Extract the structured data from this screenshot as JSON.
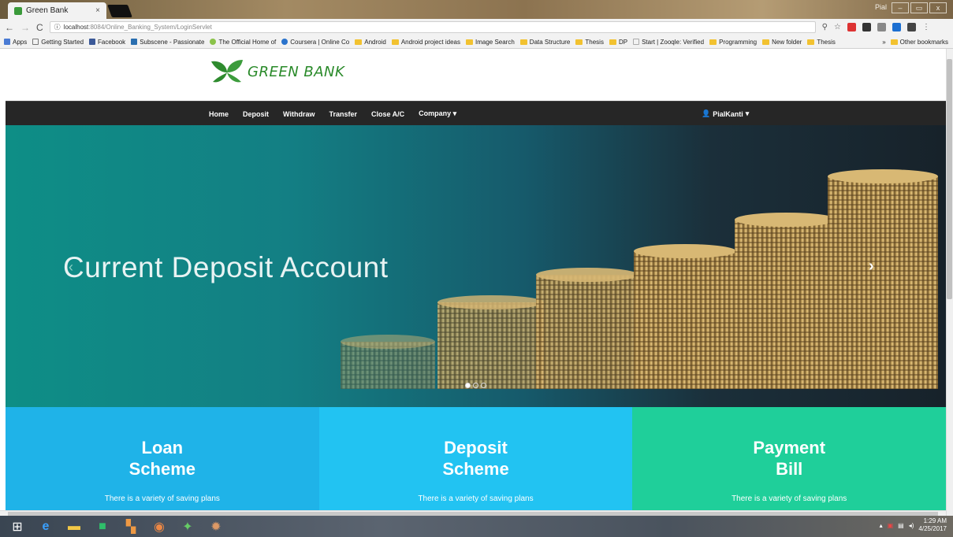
{
  "browser": {
    "tab_title": "Green Bank",
    "tab_close": "×",
    "url_host": "localhost",
    "url_path": ":8084/Online_Banking_System/LoginServlet",
    "win_controls": [
      "–",
      "▭",
      "x"
    ]
  },
  "bookmarks": {
    "items": [
      {
        "label": "Apps",
        "kind": "apps"
      },
      {
        "label": "Getting Started",
        "kind": "page"
      },
      {
        "label": "Facebook",
        "kind": "fb"
      },
      {
        "label": "Subscene - Passionate",
        "kind": "s"
      },
      {
        "label": "The Official Home of",
        "kind": "page"
      },
      {
        "label": "Coursera | Online Co",
        "kind": "page"
      },
      {
        "label": "Android",
        "kind": "folder"
      },
      {
        "label": "Android project ideas",
        "kind": "folder"
      },
      {
        "label": "Image Search",
        "kind": "folder"
      },
      {
        "label": "Data Structure",
        "kind": "folder"
      },
      {
        "label": "Thesis",
        "kind": "folder"
      },
      {
        "label": "DP",
        "kind": "folder"
      },
      {
        "label": "Start | Zooqle: Verified",
        "kind": "page"
      },
      {
        "label": "Programming",
        "kind": "folder"
      },
      {
        "label": "New folder",
        "kind": "folder"
      },
      {
        "label": "Thesis",
        "kind": "folder"
      }
    ],
    "more": "»",
    "other": "Other bookmarks"
  },
  "site": {
    "logo_text": "GREEN BANK",
    "nav": [
      "Home",
      "Deposit",
      "Withdraw",
      "Transfer",
      "Close A/C",
      "Company ▾"
    ],
    "user": "PialKanti",
    "user_caret": "▾"
  },
  "carousel": {
    "caption": "Current Deposit Account",
    "prev": "‹",
    "next": "›",
    "dots": 3,
    "active_dot": 0
  },
  "cards": [
    {
      "line1": "Loan",
      "line2": "Scheme",
      "desc": "There is a variety of saving plans",
      "color": "#1fb3e8"
    },
    {
      "line1": "Deposit",
      "line2": "Scheme",
      "desc": "There is a variety of saving plans",
      "color": "#22c3f2"
    },
    {
      "line1": "Payment",
      "line2": "Bill",
      "desc": "There is a variety of saving plans",
      "color": "#1fcf9a"
    }
  ],
  "taskbar": {
    "time": "1:29 AM",
    "date": "4/25/2017"
  }
}
